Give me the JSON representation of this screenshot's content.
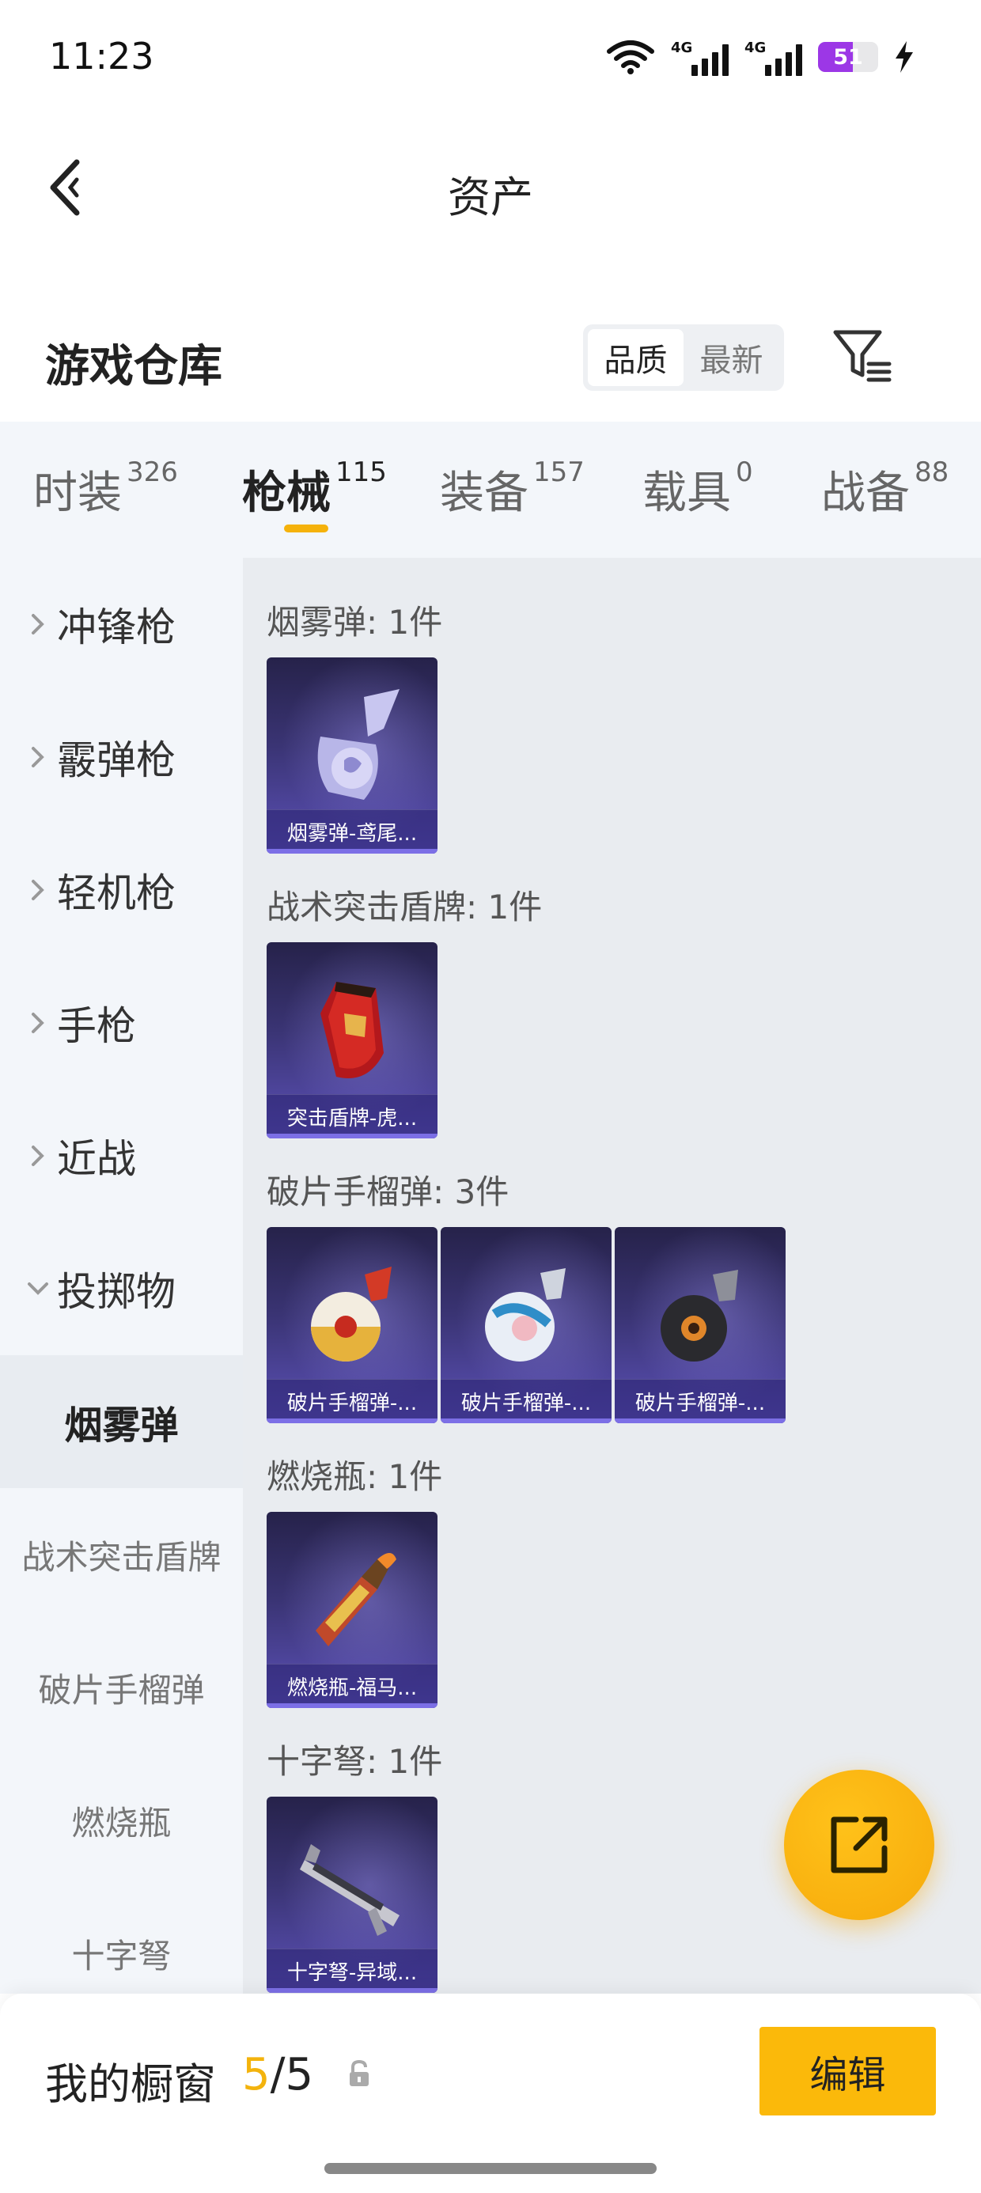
{
  "status_bar": {
    "time": "11:23",
    "battery": "51",
    "signal_1": "4G",
    "signal_2": "4G"
  },
  "nav": {
    "title": "资产"
  },
  "warehouse": {
    "title": "游戏仓库",
    "sort_options": [
      "品质",
      "最新"
    ],
    "active_sort": "品质"
  },
  "tabs": [
    {
      "label": "时装",
      "count": "326"
    },
    {
      "label": "枪械",
      "count": "115"
    },
    {
      "label": "装备",
      "count": "157"
    },
    {
      "label": "载具",
      "count": "0"
    },
    {
      "label": "战备",
      "count": "88"
    }
  ],
  "active_tab": "枪械",
  "sidebar": {
    "categories": [
      "冲锋枪",
      "霰弹枪",
      "轻机枪",
      "手枪",
      "近战",
      "投掷物"
    ],
    "expanded": "投掷物",
    "subcategories": [
      "烟雾弹",
      "战术突击盾牌",
      "破片手榴弹",
      "燃烧瓶",
      "十字弩"
    ],
    "active_sub": "烟雾弹"
  },
  "sections": [
    {
      "title": "烟雾弹: 1件",
      "items": [
        "烟雾弹-鸢尾..."
      ]
    },
    {
      "title": "战术突击盾牌: 1件",
      "items": [
        "突击盾牌-虎..."
      ]
    },
    {
      "title": "破片手榴弹: 3件",
      "items": [
        "破片手榴弹-...",
        "破片手榴弹-...",
        "破片手榴弹-..."
      ]
    },
    {
      "title": "燃烧瓶: 1件",
      "items": [
        "燃烧瓶-福马..."
      ]
    },
    {
      "title": "十字弩: 1件",
      "items": [
        "十字弩-异域..."
      ]
    }
  ],
  "bottom": {
    "showcase_label": "我的橱窗",
    "showcase_used": "5",
    "showcase_slash": "/",
    "showcase_total": "5",
    "edit_label": "编辑"
  },
  "colors": {
    "accent": "#f5b20b",
    "card_top": "#26224a",
    "card_bottom": "#5c51b8",
    "battery": "#9c37e6"
  }
}
